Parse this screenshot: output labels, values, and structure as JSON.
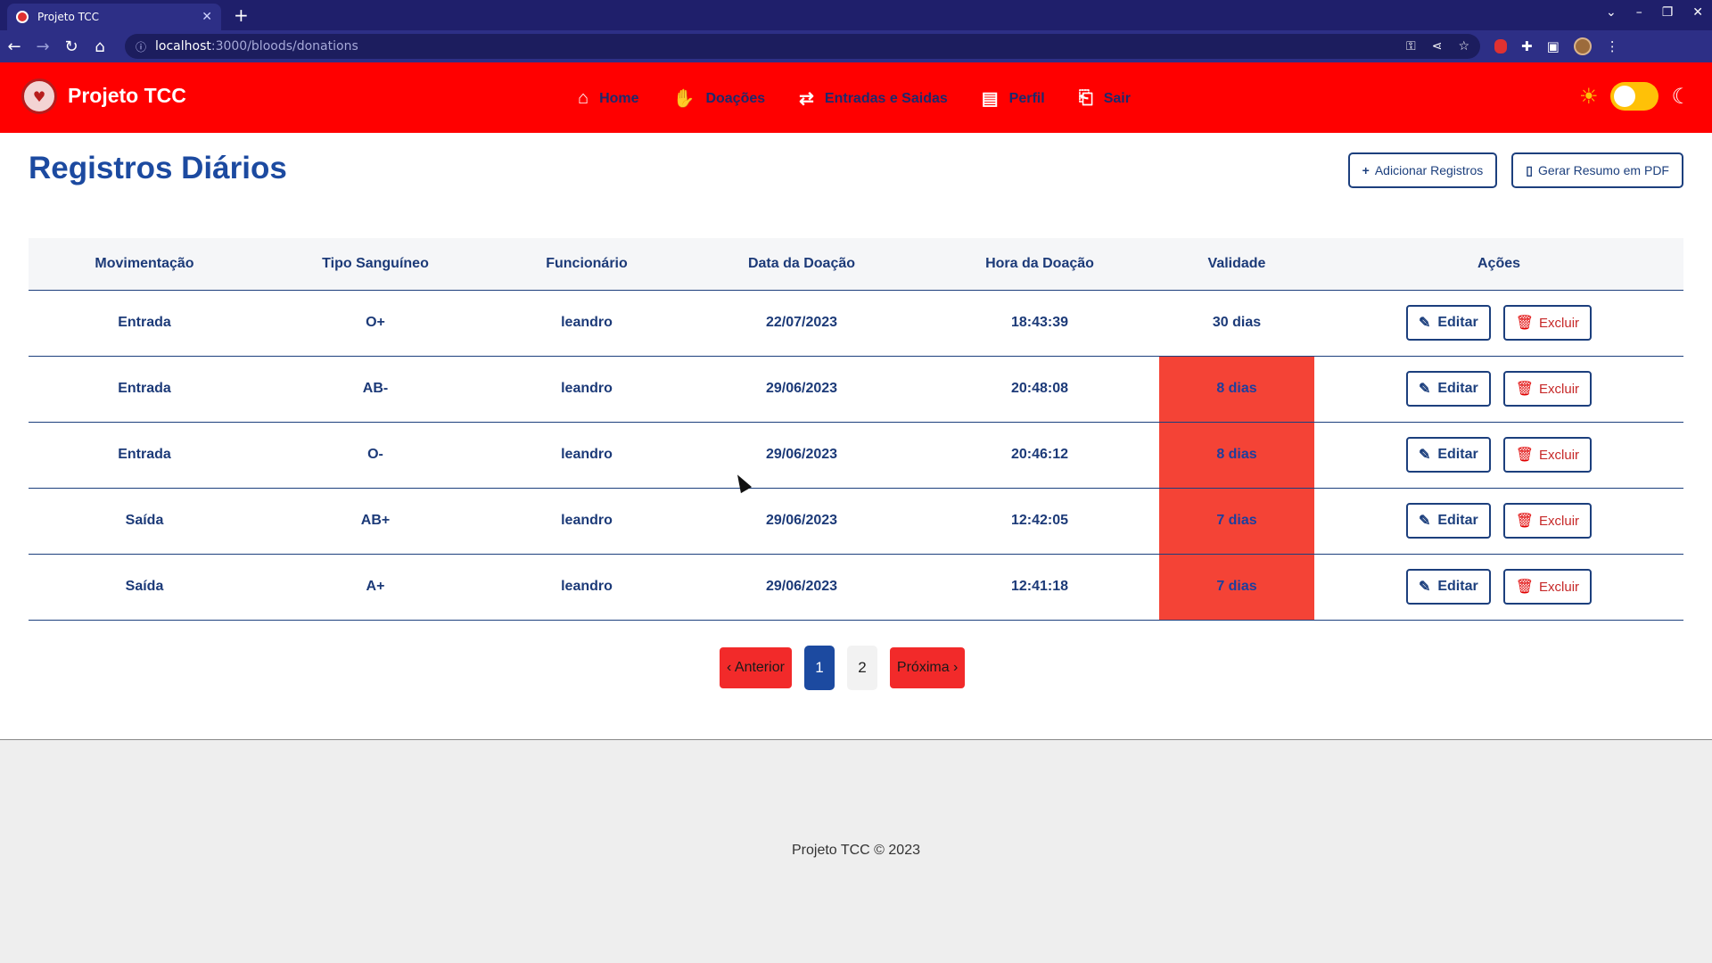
{
  "browser": {
    "tab_title": "Projeto TCC",
    "tab_close": "✕",
    "new_tab": "+",
    "url_host": "localhost",
    "url_path": ":3000/bloods/donations"
  },
  "app": {
    "brand": "Projeto TCC",
    "nav": {
      "home": "Home",
      "doacoes": "Doações",
      "entradas": "Entradas e Saidas",
      "perfil": "Perfil",
      "sair": "Sair"
    }
  },
  "page": {
    "title": "Registros Diários",
    "add_button": "Adicionar Registros",
    "pdf_button": "Gerar Resumo em PDF"
  },
  "table": {
    "headers": {
      "movimentacao": "Movimentação",
      "tipo": "Tipo Sanguíneo",
      "funcionario": "Funcionário",
      "data": "Data da Doação",
      "hora": "Hora da Doação",
      "validade": "Validade",
      "acoes": "Ações"
    },
    "edit_label": "Editar",
    "delete_label": "Excluir",
    "rows": [
      {
        "movimentacao": "Entrada",
        "tipo": "O+",
        "funcionario": "leandro",
        "data": "22/07/2023",
        "hora": "18:43:39",
        "validade": "30 dias",
        "expired": false
      },
      {
        "movimentacao": "Entrada",
        "tipo": "AB-",
        "funcionario": "leandro",
        "data": "29/06/2023",
        "hora": "20:48:08",
        "validade": "8 dias",
        "expired": true
      },
      {
        "movimentacao": "Entrada",
        "tipo": "O-",
        "funcionario": "leandro",
        "data": "29/06/2023",
        "hora": "20:46:12",
        "validade": "8 dias",
        "expired": true
      },
      {
        "movimentacao": "Saída",
        "tipo": "AB+",
        "funcionario": "leandro",
        "data": "29/06/2023",
        "hora": "12:42:05",
        "validade": "7 dias",
        "expired": true
      },
      {
        "movimentacao": "Saída",
        "tipo": "A+",
        "funcionario": "leandro",
        "data": "29/06/2023",
        "hora": "12:41:18",
        "validade": "7 dias",
        "expired": true
      }
    ]
  },
  "pagination": {
    "prev": "‹ Anterior",
    "pages": [
      "1",
      "2"
    ],
    "current": "1",
    "next": "Próxima ›"
  },
  "footer": {
    "text": "Projeto TCC © 2023"
  },
  "colors": {
    "navbar": "#ff0000",
    "primary": "#1c4aa0",
    "expired_cell": "#f44336"
  }
}
